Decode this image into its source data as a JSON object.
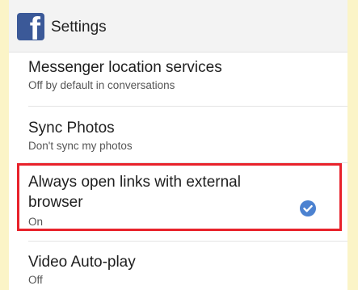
{
  "app": {
    "logo_letter": "f",
    "title": "Settings"
  },
  "settings": [
    {
      "title": "Messenger location services",
      "subtitle": "Off by default in conversations"
    },
    {
      "title": "Sync Photos",
      "subtitle": "Don't sync my photos"
    },
    {
      "title_line1": "Always open links with external",
      "title_line2": "browser",
      "subtitle": "On",
      "checked": true
    },
    {
      "title": "Video Auto-play",
      "subtitle": "Off"
    }
  ],
  "colors": {
    "highlight_border": "#e8222b",
    "check_fill": "#4c82d0",
    "brand": "#3b5998"
  },
  "icons": {
    "logo": "facebook-logo-icon",
    "checkmark": "checkmark-icon"
  }
}
